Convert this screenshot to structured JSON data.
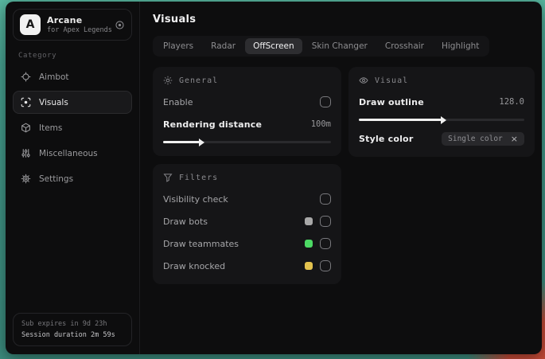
{
  "sidebar": {
    "logo_letter": "A",
    "app_name": "Arcane",
    "app_subtitle": "for Apex Legends",
    "category_label": "Category",
    "items": [
      {
        "label": "Aimbot",
        "active": false
      },
      {
        "label": "Visuals",
        "active": true
      },
      {
        "label": "Items",
        "active": false
      },
      {
        "label": "Miscellaneous",
        "active": false
      },
      {
        "label": "Settings",
        "active": false
      }
    ],
    "footer": {
      "subscription": "Sub expires in 9d 23h",
      "session": "Session duration 2m 59s"
    }
  },
  "main": {
    "title": "Visuals",
    "tabs": [
      {
        "label": "Players",
        "active": false
      },
      {
        "label": "Radar",
        "active": false
      },
      {
        "label": "OffScreen",
        "active": true
      },
      {
        "label": "Skin Changer",
        "active": false
      },
      {
        "label": "Crosshair",
        "active": false
      },
      {
        "label": "Highlight",
        "active": false
      }
    ],
    "panels": {
      "general": {
        "title": "General",
        "enable_label": "Enable",
        "enable_checked": false,
        "distance_label": "Rendering distance",
        "distance_value": "100m",
        "distance_fill": "22%"
      },
      "filters": {
        "title": "Filters",
        "rows": [
          {
            "label": "Visibility check",
            "checked": false
          },
          {
            "label": "Draw bots",
            "swatch": "#a8a8a8",
            "checked": false
          },
          {
            "label": "Draw teammates",
            "swatch": "#4cd964",
            "checked": false
          },
          {
            "label": "Draw knocked",
            "swatch": "#e3c24e",
            "checked": false
          }
        ]
      },
      "visual": {
        "title": "Visual",
        "outline_label": "Draw outline",
        "outline_value": "128.0",
        "outline_fill": "50%",
        "style_label": "Style color",
        "style_value": "Single color",
        "clear_glyph": "×"
      }
    }
  },
  "colors": {
    "desktop_teal": "#46a08f",
    "desktop_red": "#c44a37",
    "window_bg": "#0d0d0e",
    "panel_bg": "#151517",
    "swatch_gray": "#a8a8a8",
    "swatch_green": "#4cd964",
    "swatch_yellow": "#e3c24e"
  }
}
